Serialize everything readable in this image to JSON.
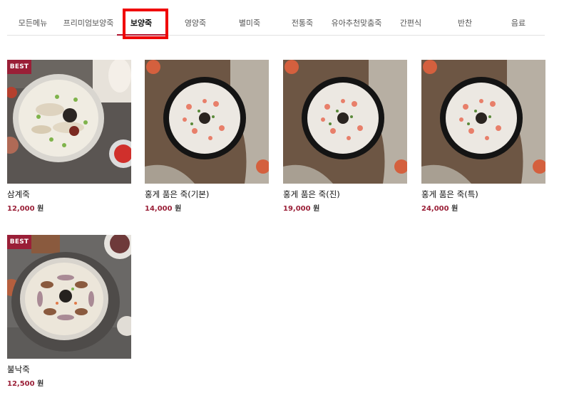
{
  "category_tabs": [
    {
      "label": "모든메뉴",
      "active": false
    },
    {
      "label": "프리미엄보양죽",
      "active": false
    },
    {
      "label": "보양죽",
      "active": true
    },
    {
      "label": "영양죽",
      "active": false
    },
    {
      "label": "별미죽",
      "active": false
    },
    {
      "label": "전통죽",
      "active": false
    },
    {
      "label": "유아추천맞춤죽",
      "active": false
    },
    {
      "label": "간편식",
      "active": false
    },
    {
      "label": "반찬",
      "active": false
    },
    {
      "label": "음료",
      "active": false
    }
  ],
  "products": [
    {
      "name": "삼계죽",
      "price": "12,000",
      "unit": "원",
      "badge": "BEST",
      "image": "samgye-porridge-photo"
    },
    {
      "name": "홍게 품은 죽(기본)",
      "price": "14,000",
      "unit": "원",
      "badge": "",
      "image": "red-crab-porridge-photo"
    },
    {
      "name": "홍게 품은 죽(진)",
      "price": "19,000",
      "unit": "원",
      "badge": "",
      "image": "red-crab-porridge-photo"
    },
    {
      "name": "홍게 품은 죽(특)",
      "price": "24,000",
      "unit": "원",
      "badge": "",
      "image": "red-crab-porridge-photo"
    },
    {
      "name": "불낙죽",
      "price": "12,500",
      "unit": "원",
      "badge": "BEST",
      "image": "bulnak-porridge-photo"
    }
  ],
  "colors": {
    "accent": "#9a1f37",
    "active_tab_underline": "#b1142f",
    "highlight_box": "#f00000"
  }
}
